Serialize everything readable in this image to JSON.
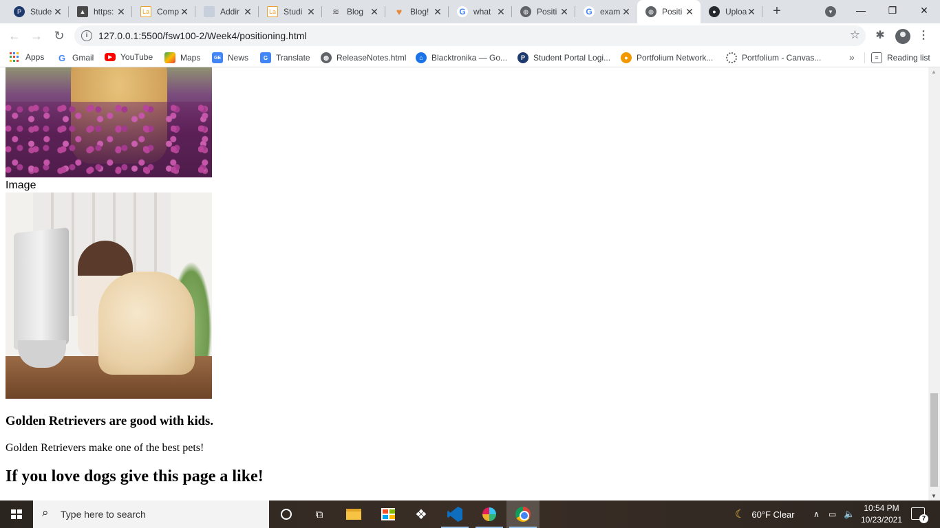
{
  "browser": {
    "tabs": [
      {
        "title": "Stude",
        "favicon": "student-portal-icon",
        "color": "#1e3a6e"
      },
      {
        "title": "https:",
        "favicon": "chart-icon",
        "color": "#4a4a4a"
      },
      {
        "title": "Comp",
        "favicon": "la-icon",
        "color": "#f0a030"
      },
      {
        "title": "Addir",
        "favicon": "doc-icon",
        "color": "#b0b8c8"
      },
      {
        "title": "Studi",
        "favicon": "la-icon",
        "color": "#f0a030"
      },
      {
        "title": "Blog",
        "favicon": "stack-icon",
        "color": "#555555"
      },
      {
        "title": "Blog!",
        "favicon": "heart-icon",
        "color": "#e8893a"
      },
      {
        "title": "what",
        "favicon": "google-icon",
        "color": "#4285f4"
      },
      {
        "title": "Positi",
        "favicon": "globe-icon",
        "color": "#5f6368"
      },
      {
        "title": "exam",
        "favicon": "google-icon",
        "color": "#4285f4"
      },
      {
        "title": "Positi",
        "favicon": "globe-icon",
        "color": "#5f6368",
        "active": true
      },
      {
        "title": "Uploa",
        "favicon": "github-icon",
        "color": "#24292e"
      }
    ],
    "url": "127.0.0.1:5500/fsw100-2/Week4/positioning.html",
    "bookmarks": [
      {
        "label": "Apps",
        "icon": "apps-grid-icon"
      },
      {
        "label": "Gmail",
        "icon": "google-icon",
        "color": "#4285f4"
      },
      {
        "label": "YouTube",
        "icon": "youtube-icon",
        "color": "#ff0000"
      },
      {
        "label": "Maps",
        "icon": "maps-icon",
        "color": "#34a853"
      },
      {
        "label": "News",
        "icon": "news-icon",
        "color": "#4285f4"
      },
      {
        "label": "Translate",
        "icon": "translate-icon",
        "color": "#4285f4"
      },
      {
        "label": "ReleaseNotes.html",
        "icon": "globe-icon",
        "color": "#5f6368"
      },
      {
        "label": "Blacktronika — Go...",
        "icon": "bank-icon",
        "color": "#1a73e8"
      },
      {
        "label": "Student Portal Logi...",
        "icon": "student-portal-icon",
        "color": "#1e3a6e"
      },
      {
        "label": "Portfolium Network...",
        "icon": "portfolium-icon",
        "color": "#f29900"
      },
      {
        "label": "Portfolium - Canvas...",
        "icon": "canvas-icon",
        "color": "#5f6368"
      }
    ],
    "reading_list": "Reading list"
  },
  "page": {
    "image_caption": "Image",
    "heading3": "Golden Retrievers are good with kids.",
    "paragraph": "Golden Retrievers make one of the best pets!",
    "heading2": "If you love dogs give this page a like!"
  },
  "taskbar": {
    "search_placeholder": "Type here to search",
    "weather": "60°F  Clear",
    "time": "10:54 PM",
    "date": "10/23/2021",
    "notification_count": "7"
  }
}
